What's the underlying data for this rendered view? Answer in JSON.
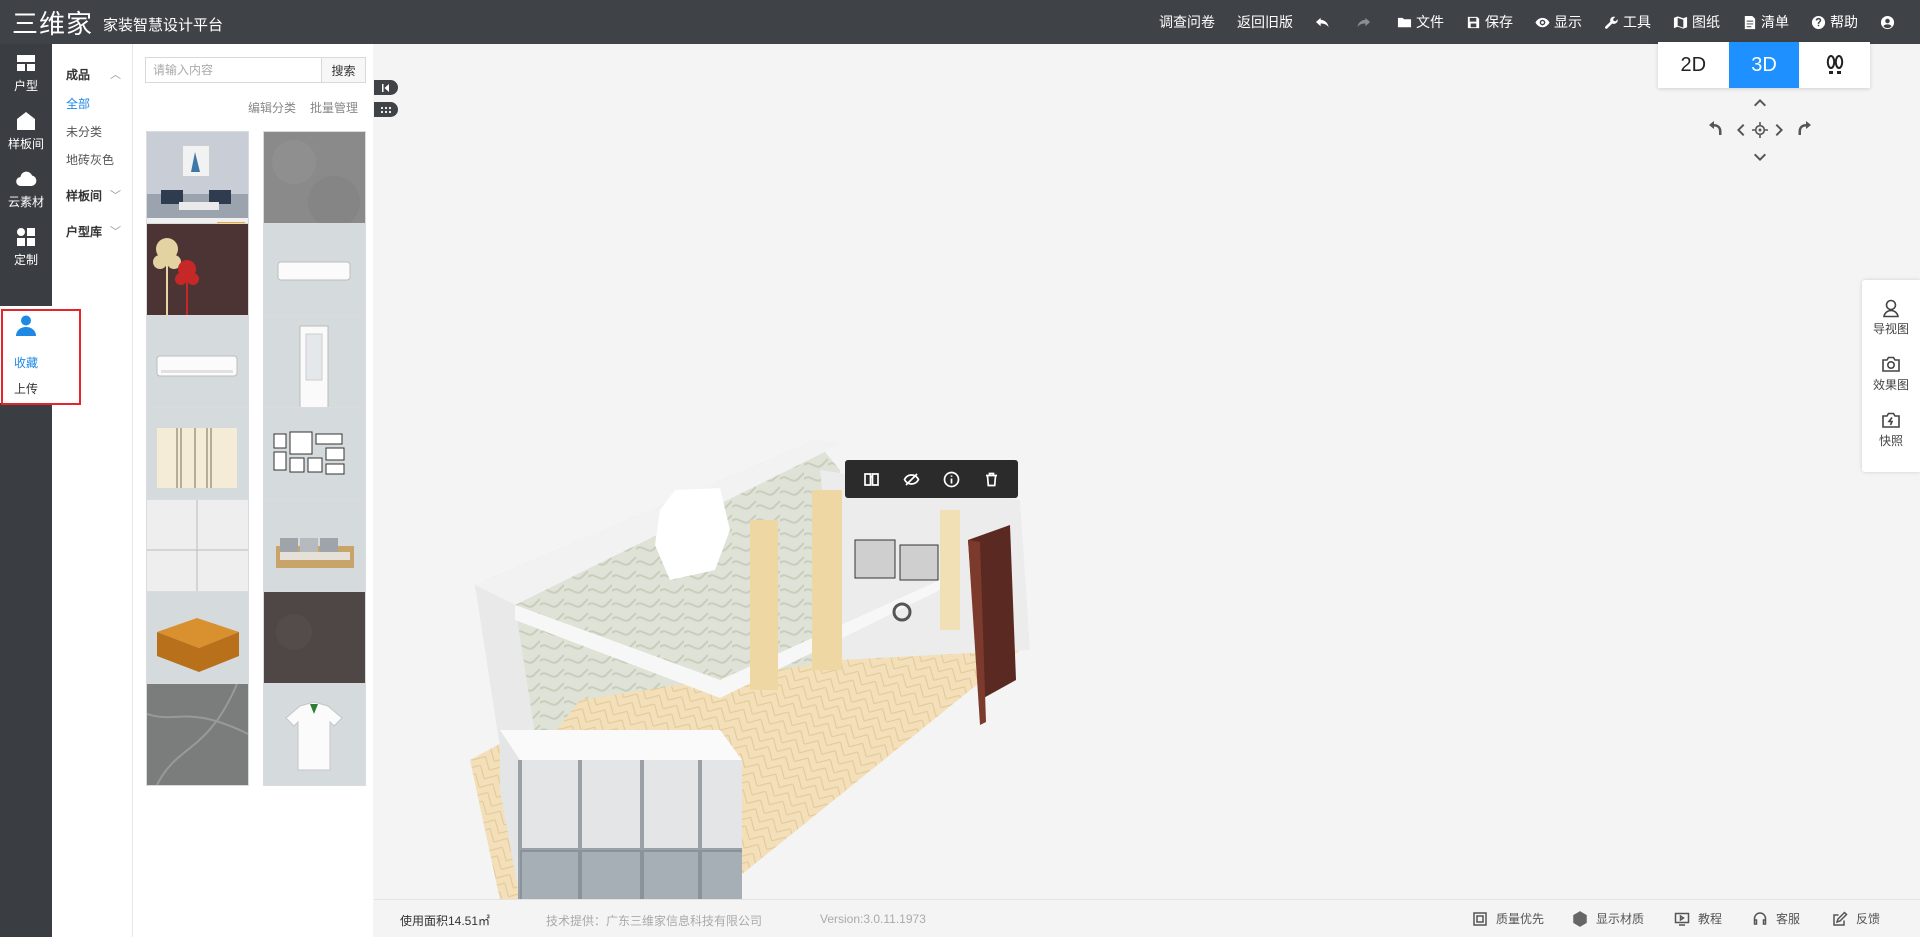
{
  "app": {
    "logo_mark": "三维家",
    "title": "家装智慧设计平台"
  },
  "topbar": {
    "survey": "调查问卷",
    "back_old": "返回旧版",
    "file": "文件",
    "save": "保存",
    "display": "显示",
    "tools": "工具",
    "drawings": "图纸",
    "list": "清单",
    "help": "帮助"
  },
  "leftnav": {
    "items": [
      {
        "label": "户型",
        "icon": "floorplan-icon"
      },
      {
        "label": "样板间",
        "icon": "house-icon"
      },
      {
        "label": "云素材",
        "icon": "cloud-icon"
      },
      {
        "label": "定制",
        "icon": "custom-grid-icon"
      }
    ],
    "sub_favorites": "收藏",
    "sub_upload": "上传"
  },
  "categories": {
    "finished": "成品",
    "all": "全部",
    "uncategorized": "未分类",
    "tile_gray": "地砖灰色",
    "showroom": "样板间",
    "floorplan_lib": "户型库"
  },
  "panel": {
    "search_placeholder": "请输入内容",
    "search_button": "搜索",
    "edit_category": "编辑分类",
    "batch_manage": "批量管理"
  },
  "thumbnails": [
    "living-room-scene",
    "gray-concrete",
    "tree-wallpaper",
    "white-ac-unit",
    "white-ac-unit-2",
    "white-window-frame",
    "striped-panel",
    "photo-frames-wall",
    "marble-tile",
    "sofa",
    "wooden-coffee-table",
    "dark-stone",
    "gray-marble",
    "white-shirt"
  ],
  "thumb_badge": "170600",
  "view": {
    "mode_2d": "2D",
    "mode_3d": "3D",
    "active": "3D"
  },
  "right_tools": {
    "guide": "导视图",
    "render": "效果图",
    "snapshot": "快照"
  },
  "status": {
    "area": "使用面积14.51㎡",
    "provider": "技术提供：广东三维家信息科技有限公司",
    "version": "Version:3.0.11.1973",
    "quality": "质量优先",
    "show_material": "显示材质",
    "tutorial": "教程",
    "service": "客服",
    "feedback": "反馈"
  },
  "colors": {
    "topbar": "#3f4246",
    "accent": "#1e90ff",
    "highlight": "#e5252a"
  }
}
